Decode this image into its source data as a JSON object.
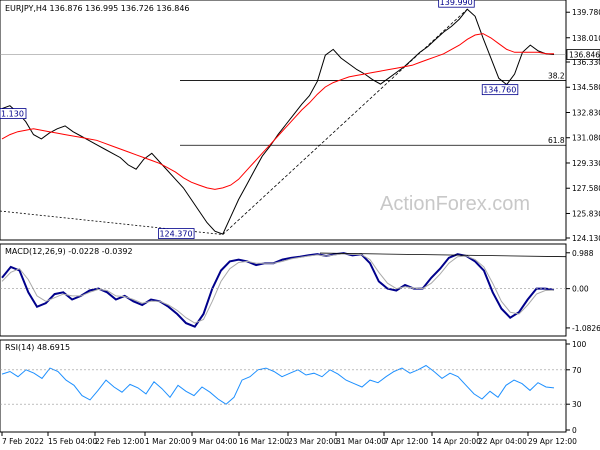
{
  "chart_data": [
    {
      "type": "line",
      "title": "EURJPY,H4 136.876 136.995 136.726 136.846",
      "y_ticks": [
        "139.780",
        "138.010",
        "136.330",
        "134.580",
        "132.830",
        "131.080",
        "129.330",
        "127.580",
        "125.830",
        "124.130"
      ],
      "ylim": [
        124.13,
        140.35
      ],
      "current_price": "136.846",
      "x_ticks": [
        "7 Feb 2022",
        "15 Feb 04:00",
        "22 Feb 12:00",
        "1 Mar 20:00",
        "9 Mar 04:00",
        "16 Mar 12:00",
        "23 Mar 20:00",
        "31 Mar 04:00",
        "7 Apr 12:00",
        "14 Apr 20:00",
        "22 Apr 04:00",
        "29 Apr 12:00"
      ],
      "fib_levels": [
        {
          "label": "38.2",
          "price": 135.05
        },
        {
          "label": "61.8",
          "price": 130.56
        }
      ],
      "annotations": [
        {
          "text": "139.990",
          "x": 0.775,
          "price": 139.99
        },
        {
          "text": "134.760",
          "x": 0.852,
          "price": 134.76
        },
        {
          "text": "124.370",
          "x": 0.28,
          "price": 124.37
        },
        {
          "text": "1.130",
          "x": 0.0,
          "price": 133.1
        }
      ],
      "series": [
        {
          "values": [
            133.1,
            133.3,
            132.8,
            132.2,
            131.3,
            131.0,
            131.4,
            131.7,
            131.9,
            131.5,
            131.2,
            130.9,
            130.6,
            130.3,
            130.0,
            129.7,
            129.2,
            128.9,
            129.6,
            130.0,
            129.4,
            128.8,
            128.2,
            127.6,
            126.8,
            126.0,
            125.2,
            124.6,
            124.4,
            125.6,
            126.8,
            127.8,
            128.8,
            129.8,
            130.5,
            131.3,
            132.0,
            132.7,
            133.4,
            134.0,
            135.0,
            136.8,
            137.2,
            136.6,
            136.2,
            135.8,
            135.5,
            135.1,
            134.8,
            135.2,
            135.6,
            136.0,
            136.5,
            137.0,
            137.4,
            137.9,
            138.4,
            138.8,
            139.3,
            139.99,
            139.5,
            138.0,
            136.6,
            135.2,
            134.76,
            135.5,
            137.0,
            137.5,
            137.1,
            136.9,
            136.85
          ],
          "color": "#000000"
        },
        {
          "values": [
            131.0,
            131.3,
            131.5,
            131.6,
            131.7,
            131.6,
            131.5,
            131.4,
            131.3,
            131.2,
            131.1,
            131.0,
            130.9,
            130.7,
            130.5,
            130.3,
            130.1,
            129.9,
            129.7,
            129.5,
            129.3,
            129.0,
            128.7,
            128.3,
            128.0,
            127.8,
            127.6,
            127.5,
            127.6,
            127.8,
            128.2,
            128.8,
            129.4,
            130.0,
            130.6,
            131.2,
            131.8,
            132.4,
            133.0,
            133.5,
            134.1,
            134.6,
            134.9,
            135.1,
            135.3,
            135.4,
            135.5,
            135.6,
            135.7,
            135.8,
            135.9,
            136.0,
            136.1,
            136.3,
            136.5,
            136.7,
            136.9,
            137.2,
            137.5,
            137.9,
            138.2,
            138.3,
            138.0,
            137.6,
            137.2,
            137.0,
            137.0,
            137.0,
            137.0,
            136.9,
            136.9
          ],
          "color": "#ff0000"
        }
      ]
    },
    {
      "type": "line",
      "title": "MACD(12,26,9) -0.0228 -0.0392",
      "y_ticks": [
        "0.988",
        "0.00",
        "-1.0826"
      ],
      "ylim": [
        -1.25,
        1.12
      ],
      "series": [
        {
          "values": [
            0.3,
            0.6,
            0.5,
            -0.1,
            -0.5,
            -0.4,
            -0.15,
            -0.1,
            -0.3,
            -0.2,
            -0.05,
            0.0,
            -0.1,
            -0.3,
            -0.2,
            -0.35,
            -0.45,
            -0.3,
            -0.35,
            -0.5,
            -0.7,
            -0.95,
            -1.05,
            -0.7,
            0.0,
            0.5,
            0.75,
            0.8,
            0.75,
            0.65,
            0.7,
            0.7,
            0.8,
            0.85,
            0.88,
            0.92,
            0.95,
            0.9,
            0.95,
            0.98,
            0.92,
            0.95,
            0.7,
            0.2,
            0.0,
            -0.05,
            0.1,
            0.0,
            0.0,
            0.3,
            0.55,
            0.85,
            0.95,
            0.9,
            0.75,
            0.5,
            -0.1,
            -0.55,
            -0.8,
            -0.65,
            -0.3,
            0.0,
            0.0,
            -0.03
          ],
          "color": "#00008b"
        },
        {
          "values": [
            0.2,
            0.45,
            0.55,
            0.25,
            -0.2,
            -0.35,
            -0.25,
            -0.15,
            -0.2,
            -0.2,
            -0.1,
            -0.02,
            -0.05,
            -0.2,
            -0.22,
            -0.3,
            -0.4,
            -0.35,
            -0.35,
            -0.45,
            -0.6,
            -0.8,
            -0.95,
            -0.85,
            -0.35,
            0.2,
            0.55,
            0.72,
            0.75,
            0.7,
            0.7,
            0.7,
            0.75,
            0.82,
            0.86,
            0.9,
            0.93,
            0.9,
            0.93,
            0.96,
            0.94,
            0.94,
            0.8,
            0.45,
            0.15,
            0.0,
            0.05,
            0.02,
            0.0,
            0.15,
            0.4,
            0.7,
            0.88,
            0.9,
            0.8,
            0.6,
            0.15,
            -0.35,
            -0.65,
            -0.7,
            -0.45,
            -0.15,
            -0.05,
            -0.04
          ],
          "color": "#aaaaaa"
        }
      ]
    },
    {
      "type": "line",
      "title": "RSI(14) 48.6915",
      "y_ticks": [
        "100",
        "70",
        "30",
        "0"
      ],
      "ylim": [
        0,
        100
      ],
      "series": [
        {
          "values": [
            65,
            68,
            62,
            70,
            66,
            60,
            72,
            68,
            58,
            52,
            40,
            35,
            46,
            58,
            50,
            44,
            53,
            49,
            42,
            56,
            48,
            38,
            52,
            45,
            40,
            50,
            44,
            36,
            30,
            38,
            58,
            62,
            70,
            72,
            68,
            62,
            66,
            70,
            64,
            66,
            62,
            70,
            65,
            58,
            54,
            50,
            58,
            55,
            62,
            68,
            72,
            66,
            70,
            75,
            68,
            60,
            66,
            62,
            52,
            42,
            36,
            45,
            38,
            52,
            58,
            54,
            46,
            55,
            50,
            49
          ],
          "color": "#1e90ff"
        }
      ]
    }
  ]
}
